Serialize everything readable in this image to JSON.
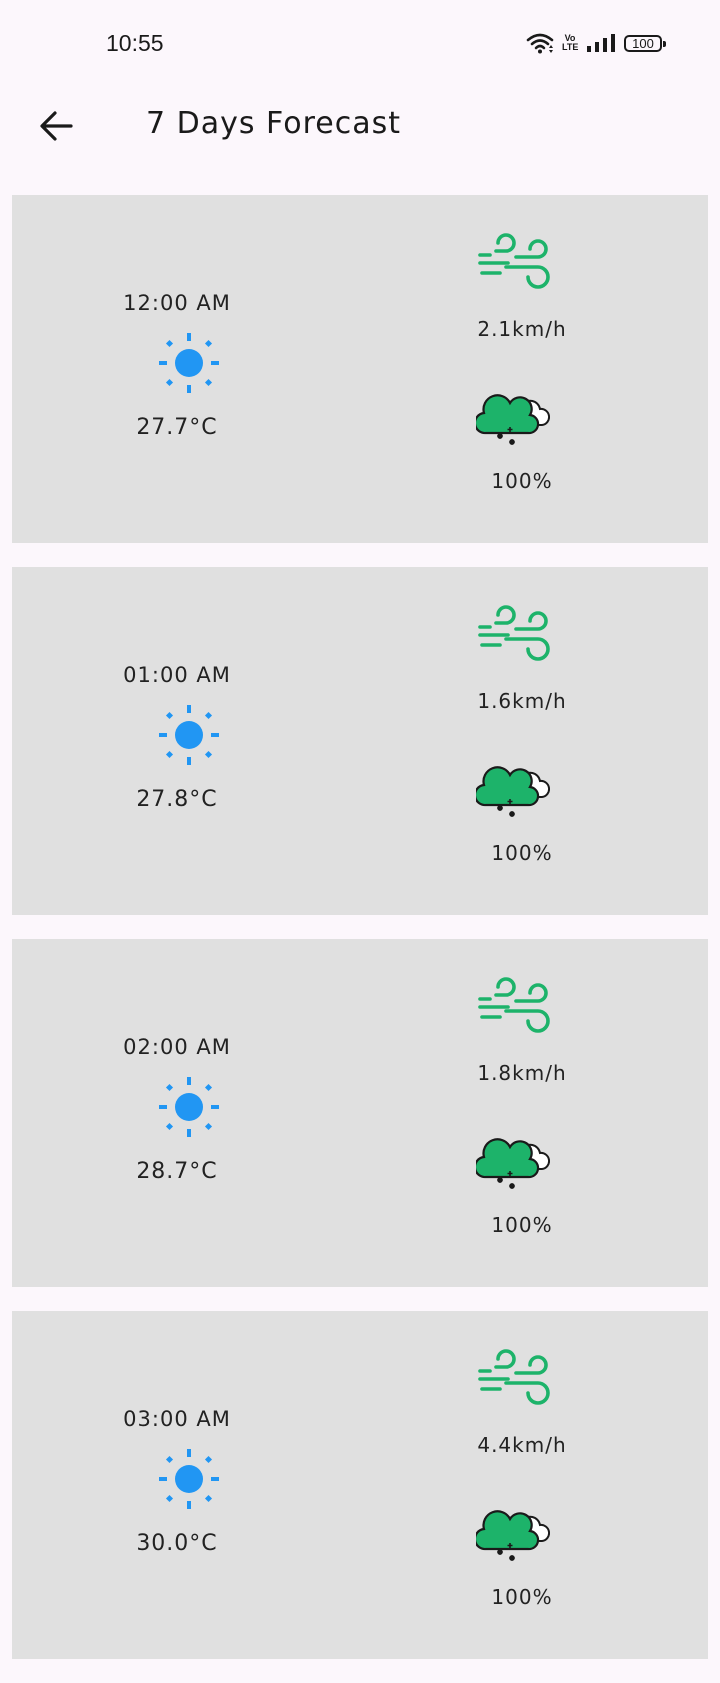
{
  "status_bar": {
    "time": "10:55",
    "volte_top": "Vo",
    "volte_bottom": "LTE",
    "battery": "100"
  },
  "app_bar": {
    "title": "7 Days Forecast",
    "back_icon": "arrow-left-icon"
  },
  "colors": {
    "background": "#fcf7fc",
    "card": "#e0e0e0",
    "sun": "#2196f3",
    "wind": "#1db36a",
    "cloud": "#1db36a"
  },
  "forecast": [
    {
      "time": "12:00 AM",
      "temp": "27.7°C",
      "wind": "2.1km/h",
      "rain": "100%",
      "weather_icon": "sun-icon",
      "wind_icon": "wind-icon",
      "rain_icon": "cloud-snow-icon"
    },
    {
      "time": "01:00 AM",
      "temp": "27.8°C",
      "wind": "1.6km/h",
      "rain": "100%",
      "weather_icon": "sun-icon",
      "wind_icon": "wind-icon",
      "rain_icon": "cloud-snow-icon"
    },
    {
      "time": "02:00 AM",
      "temp": "28.7°C",
      "wind": "1.8km/h",
      "rain": "100%",
      "weather_icon": "sun-icon",
      "wind_icon": "wind-icon",
      "rain_icon": "cloud-snow-icon"
    },
    {
      "time": "03:00 AM",
      "temp": "30.0°C",
      "wind": "4.4km/h",
      "rain": "100%",
      "weather_icon": "sun-icon",
      "wind_icon": "wind-icon",
      "rain_icon": "cloud-snow-icon"
    }
  ]
}
